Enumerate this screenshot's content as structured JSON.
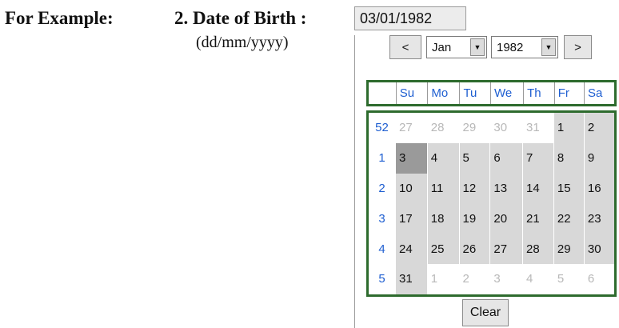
{
  "instruction": {
    "example_label": "For Example:",
    "field_label": "2. Date of Birth :",
    "field_hint": "(dd/mm/yyyy)"
  },
  "date_input": {
    "value": "03/01/1982"
  },
  "calendar": {
    "prev_label": "<",
    "next_label": ">",
    "month": "Jan",
    "year": "1982",
    "weekdays": [
      "Su",
      "Mo",
      "Tu",
      "We",
      "Th",
      "Fr",
      "Sa"
    ],
    "weeks": [
      {
        "week": "52",
        "days": [
          {
            "d": "27",
            "in": false
          },
          {
            "d": "28",
            "in": false
          },
          {
            "d": "29",
            "in": false
          },
          {
            "d": "30",
            "in": false
          },
          {
            "d": "31",
            "in": false
          },
          {
            "d": "1",
            "in": true
          },
          {
            "d": "2",
            "in": true
          }
        ]
      },
      {
        "week": "1",
        "days": [
          {
            "d": "3",
            "in": true,
            "selected": true
          },
          {
            "d": "4",
            "in": true
          },
          {
            "d": "5",
            "in": true
          },
          {
            "d": "6",
            "in": true
          },
          {
            "d": "7",
            "in": true
          },
          {
            "d": "8",
            "in": true
          },
          {
            "d": "9",
            "in": true
          }
        ]
      },
      {
        "week": "2",
        "days": [
          {
            "d": "10",
            "in": true
          },
          {
            "d": "11",
            "in": true
          },
          {
            "d": "12",
            "in": true
          },
          {
            "d": "13",
            "in": true
          },
          {
            "d": "14",
            "in": true
          },
          {
            "d": "15",
            "in": true
          },
          {
            "d": "16",
            "in": true
          }
        ]
      },
      {
        "week": "3",
        "days": [
          {
            "d": "17",
            "in": true
          },
          {
            "d": "18",
            "in": true
          },
          {
            "d": "19",
            "in": true
          },
          {
            "d": "20",
            "in": true
          },
          {
            "d": "21",
            "in": true
          },
          {
            "d": "22",
            "in": true
          },
          {
            "d": "23",
            "in": true
          }
        ]
      },
      {
        "week": "4",
        "days": [
          {
            "d": "24",
            "in": true
          },
          {
            "d": "25",
            "in": true
          },
          {
            "d": "26",
            "in": true
          },
          {
            "d": "27",
            "in": true
          },
          {
            "d": "28",
            "in": true
          },
          {
            "d": "29",
            "in": true
          },
          {
            "d": "30",
            "in": true
          }
        ]
      },
      {
        "week": "5",
        "days": [
          {
            "d": "31",
            "in": true
          },
          {
            "d": "1",
            "in": false
          },
          {
            "d": "2",
            "in": false
          },
          {
            "d": "3",
            "in": false
          },
          {
            "d": "4",
            "in": false
          },
          {
            "d": "5",
            "in": false
          },
          {
            "d": "6",
            "in": false
          }
        ]
      }
    ],
    "clear_label": "Clear"
  },
  "colors": {
    "border_green": "#2d6b2d",
    "weekday_blue": "#1f5fd1",
    "selected_gray": "#9a9a9a",
    "cell_gray": "#d8d8d8"
  }
}
